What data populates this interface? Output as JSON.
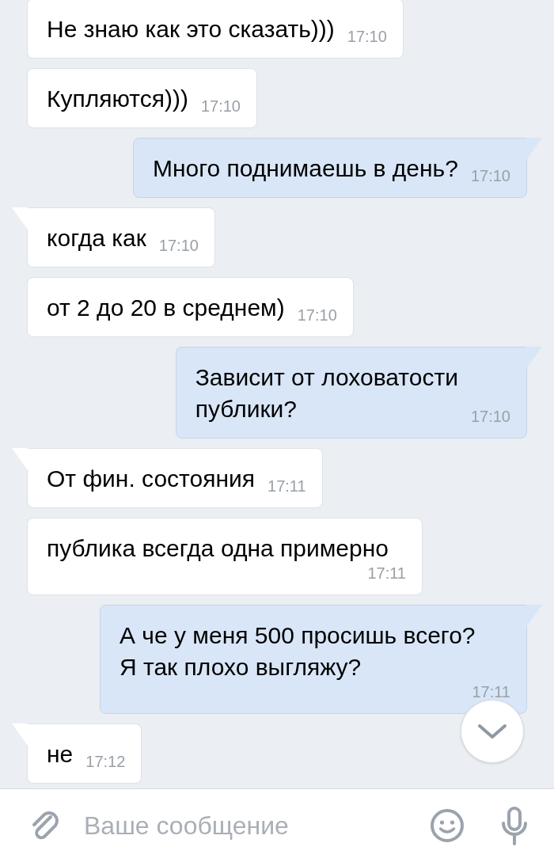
{
  "messages": [
    {
      "outgoing": false,
      "tail": false,
      "text": "Не знаю как это сказать)))",
      "time": "17:10"
    },
    {
      "outgoing": false,
      "tail": false,
      "text": "Купляются)))",
      "time": "17:10"
    },
    {
      "outgoing": true,
      "tail": true,
      "text": "Много поднимаешь в день?",
      "time": "17:10"
    },
    {
      "outgoing": false,
      "tail": true,
      "text": "когда как",
      "time": "17:10"
    },
    {
      "outgoing": false,
      "tail": false,
      "text": "от 2 до 20 в среднем)",
      "time": "17:10"
    },
    {
      "outgoing": true,
      "tail": true,
      "text": "Зависит от лоховатости\nпублики?",
      "time": "17:10"
    },
    {
      "outgoing": false,
      "tail": true,
      "text": "От фин. состояния",
      "time": "17:11"
    },
    {
      "outgoing": false,
      "tail": false,
      "text": "публика всегда одна примерно",
      "time": "17:11"
    },
    {
      "outgoing": true,
      "tail": true,
      "text": "А че у меня 500 просишь всего?\nЯ так плохо выгляжу?",
      "time": "17:11"
    },
    {
      "outgoing": false,
      "tail": true,
      "text": "не",
      "time": "17:12"
    }
  ],
  "composer": {
    "placeholder": "Ваше сообщение"
  }
}
